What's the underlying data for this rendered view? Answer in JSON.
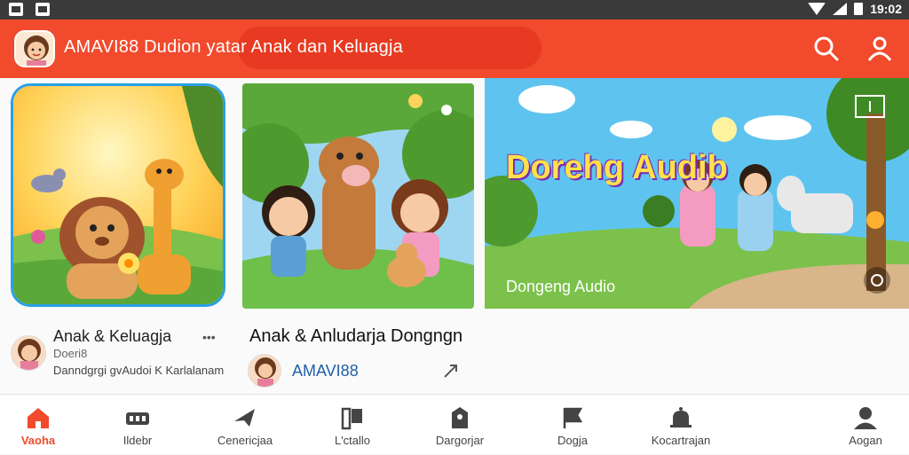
{
  "status_bar": {
    "time": "19:02"
  },
  "app_bar": {
    "title": "AMAVI88 Dudion yatar Anak dan Keluagja",
    "icons": [
      "app-logo-avatar",
      "search-icon",
      "profile-icon"
    ]
  },
  "cards": [
    {
      "title": "Anak & Keluagja",
      "channel": "Doeri8",
      "subtitle": "Danndgrgi gvAudoi K Karlalanam",
      "more_label": "•••"
    },
    {
      "title": "Anak & Anludarja Dongngn",
      "channel": "AMAVI88"
    },
    {
      "banner_title": "Dorehg Audib",
      "caption": "Dongeng Audio"
    }
  ],
  "bottom_nav": [
    {
      "label": "Vaoha",
      "icon": "home-icon",
      "active": true
    },
    {
      "label": "Ildebr",
      "icon": "library-icon",
      "active": false
    },
    {
      "label": "Cenericjaa",
      "icon": "send-icon",
      "active": false
    },
    {
      "label": "L'ctallo",
      "icon": "catalog-icon",
      "active": false
    },
    {
      "label": "Dargorjar",
      "icon": "bookmark-icon",
      "active": false
    },
    {
      "label": "Dogja",
      "icon": "flag-icon",
      "active": false
    },
    {
      "label": "Kocartrajan",
      "icon": "bell-icon",
      "active": false
    },
    {
      "label": "Aogan",
      "icon": "account-icon",
      "active": false
    }
  ],
  "colors": {
    "accent": "#f14a2c",
    "status_bar": "#3a3a3a",
    "link_blue": "#1f5fa8"
  }
}
